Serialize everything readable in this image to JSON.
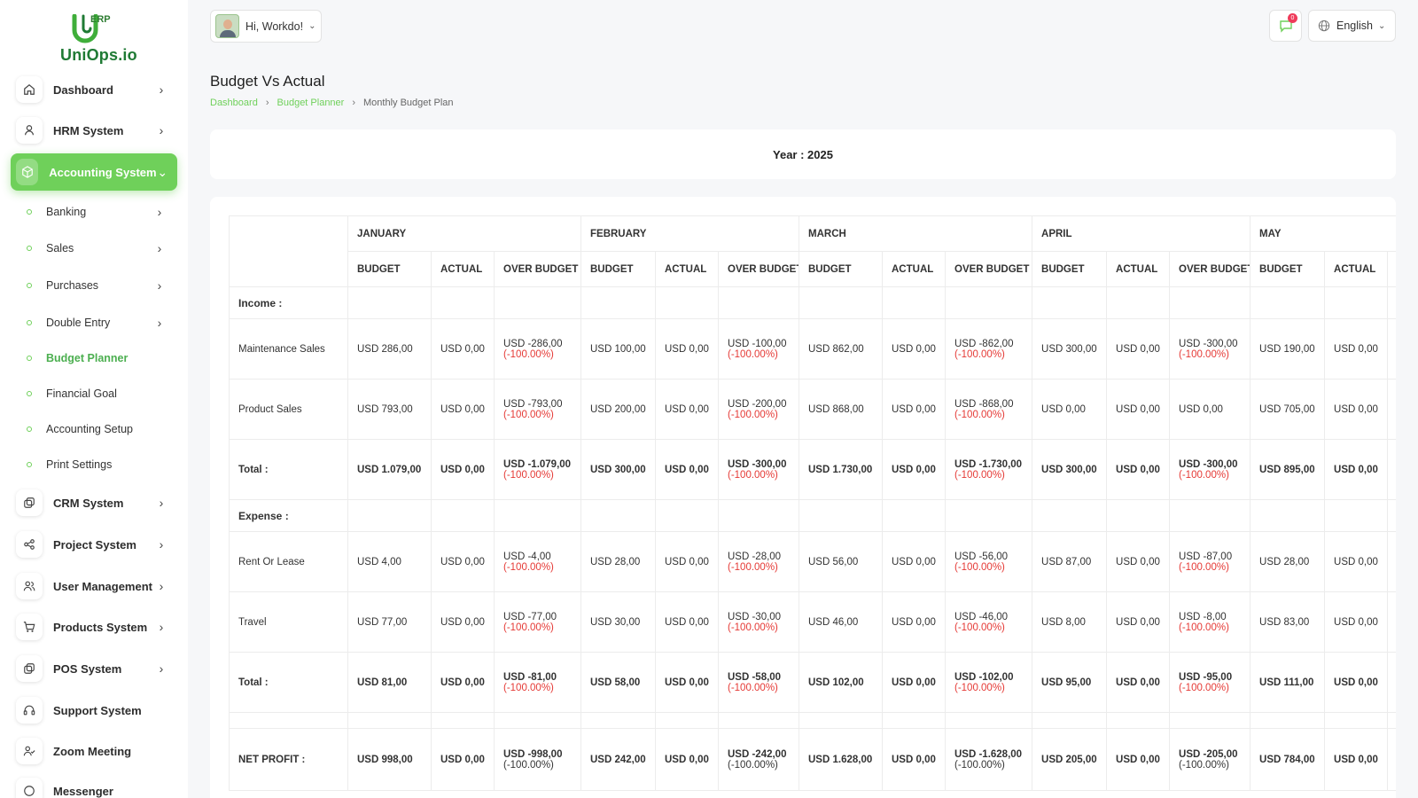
{
  "app": {
    "brand_logo_text": "UniOps.io",
    "brand_logo_badge": "ERP"
  },
  "header": {
    "greeting": "Hi, Workdo!",
    "notification_count": "0",
    "language": "English"
  },
  "sidebar": {
    "items": [
      {
        "label": "Dashboard",
        "icon": "home-icon"
      },
      {
        "label": "HRM System",
        "icon": "user-icon"
      },
      {
        "label": "Accounting System",
        "icon": "box-icon"
      },
      {
        "label": "CRM System",
        "icon": "layers-icon"
      },
      {
        "label": "Project System",
        "icon": "share-icon"
      },
      {
        "label": "User Management",
        "icon": "users-icon"
      },
      {
        "label": "Products System",
        "icon": "cart-icon"
      },
      {
        "label": "POS System",
        "icon": "layers-icon"
      },
      {
        "label": "Support System",
        "icon": "headset-icon"
      },
      {
        "label": "Zoom Meeting",
        "icon": "user-check-icon"
      },
      {
        "label": "Messenger",
        "icon": "message-icon"
      }
    ],
    "sub_items": [
      {
        "label": "Banking"
      },
      {
        "label": "Sales"
      },
      {
        "label": "Purchases"
      },
      {
        "label": "Double Entry"
      },
      {
        "label": "Budget Planner"
      },
      {
        "label": "Financial Goal"
      },
      {
        "label": "Accounting Setup"
      },
      {
        "label": "Print Settings"
      }
    ]
  },
  "page": {
    "title": "Budget Vs Actual",
    "breadcrumb": [
      "Dashboard",
      "Budget Planner",
      "Monthly Budget Plan"
    ],
    "year_label": "Year : 2025"
  },
  "table": {
    "months": [
      "JANUARY",
      "FEBRUARY",
      "MARCH",
      "APRIL",
      "MAY"
    ],
    "subheaders": [
      "BUDGET",
      "ACTUAL",
      "OVER BUDGET",
      "BUDGET",
      "ACTUAL",
      "OVER BUDGET",
      "BUDGET",
      "ACTUAL",
      "OVER BUDGET",
      "BUDGET",
      "ACTUAL",
      "OVER BUDGET",
      "BUDGET",
      "ACTUAL",
      "OVER BUDGET"
    ],
    "income_label": "Income :",
    "expense_label": "Expense :",
    "rows": {
      "maintenance": {
        "label": "Maintenance Sales",
        "cells": [
          "USD 286,00",
          "USD 0,00",
          "USD -286,00",
          "(-100.00%)",
          "USD 100,00",
          "USD 0,00",
          "USD -100,00",
          "(-100.00%)",
          "USD 862,00",
          "USD 0,00",
          "USD -862,00",
          "(-100.00%)",
          "USD 300,00",
          "USD 0,00",
          "USD -300,00",
          "(-100.00%)",
          "USD 190,00",
          "USD 0,00",
          "U",
          "("
        ]
      },
      "product": {
        "label": "Product Sales",
        "cells": [
          "USD 793,00",
          "USD 0,00",
          "USD -793,00",
          "(-100.00%)",
          "USD 200,00",
          "USD 0,00",
          "USD -200,00",
          "(-100.00%)",
          "USD 868,00",
          "USD 0,00",
          "USD -868,00",
          "(-100.00%)",
          "USD 0,00",
          "USD 0,00",
          "USD 0,00",
          "",
          "USD 705,00",
          "USD 0,00",
          "U",
          "("
        ]
      },
      "income_total": {
        "label": "Total :",
        "cells": [
          "USD 1.079,00",
          "USD 0,00",
          "USD -1.079,00",
          "(-100.00%)",
          "USD 300,00",
          "USD 0,00",
          "USD -300,00",
          "(-100.00%)",
          "USD 1.730,00",
          "USD 0,00",
          "USD -1.730,00",
          "(-100.00%)",
          "USD 300,00",
          "USD 0,00",
          "USD -300,00",
          "(-100.00%)",
          "USD 895,00",
          "USD 0,00",
          "U",
          "("
        ]
      },
      "rent": {
        "label": "Rent Or Lease",
        "cells": [
          "USD 4,00",
          "USD 0,00",
          "USD -4,00",
          "(-100.00%)",
          "USD 28,00",
          "USD 0,00",
          "USD -28,00",
          "(-100.00%)",
          "USD 56,00",
          "USD 0,00",
          "USD -56,00",
          "(-100.00%)",
          "USD 87,00",
          "USD 0,00",
          "USD -87,00",
          "(-100.00%)",
          "USD 28,00",
          "USD 0,00",
          "U",
          "("
        ]
      },
      "travel": {
        "label": "Travel",
        "cells": [
          "USD 77,00",
          "USD 0,00",
          "USD -77,00",
          "(-100.00%)",
          "USD 30,00",
          "USD 0,00",
          "USD -30,00",
          "(-100.00%)",
          "USD 46,00",
          "USD 0,00",
          "USD -46,00",
          "(-100.00%)",
          "USD 8,00",
          "USD 0,00",
          "USD -8,00",
          "(-100.00%)",
          "USD 83,00",
          "USD 0,00",
          "U",
          "("
        ]
      },
      "expense_total": {
        "label": "Total :",
        "cells": [
          "USD 81,00",
          "USD 0,00",
          "USD -81,00",
          "(-100.00%)",
          "USD 58,00",
          "USD 0,00",
          "USD -58,00",
          "(-100.00%)",
          "USD 102,00",
          "USD 0,00",
          "USD -102,00",
          "(-100.00%)",
          "USD 95,00",
          "USD 0,00",
          "USD -95,00",
          "(-100.00%)",
          "USD 111,00",
          "USD 0,00",
          "U",
          "("
        ]
      },
      "net": {
        "label": "NET PROFIT :",
        "cells": [
          "USD 998,00",
          "USD 0,00",
          "USD -998,00",
          "(-100.00%)",
          "USD 242,00",
          "USD 0,00",
          "USD -242,00",
          "(-100.00%)",
          "USD 1.628,00",
          "USD 0,00",
          "USD -1.628,00",
          "(-100.00%)",
          "USD 205,00",
          "USD 0,00",
          "USD -205,00",
          "(-100.00%)",
          "USD 784,00",
          "USD 0,00",
          "U",
          "("
        ]
      }
    }
  },
  "colors": {
    "accent": "#6fd05a",
    "negative": "#e53935",
    "brand": "#1f7a34"
  }
}
